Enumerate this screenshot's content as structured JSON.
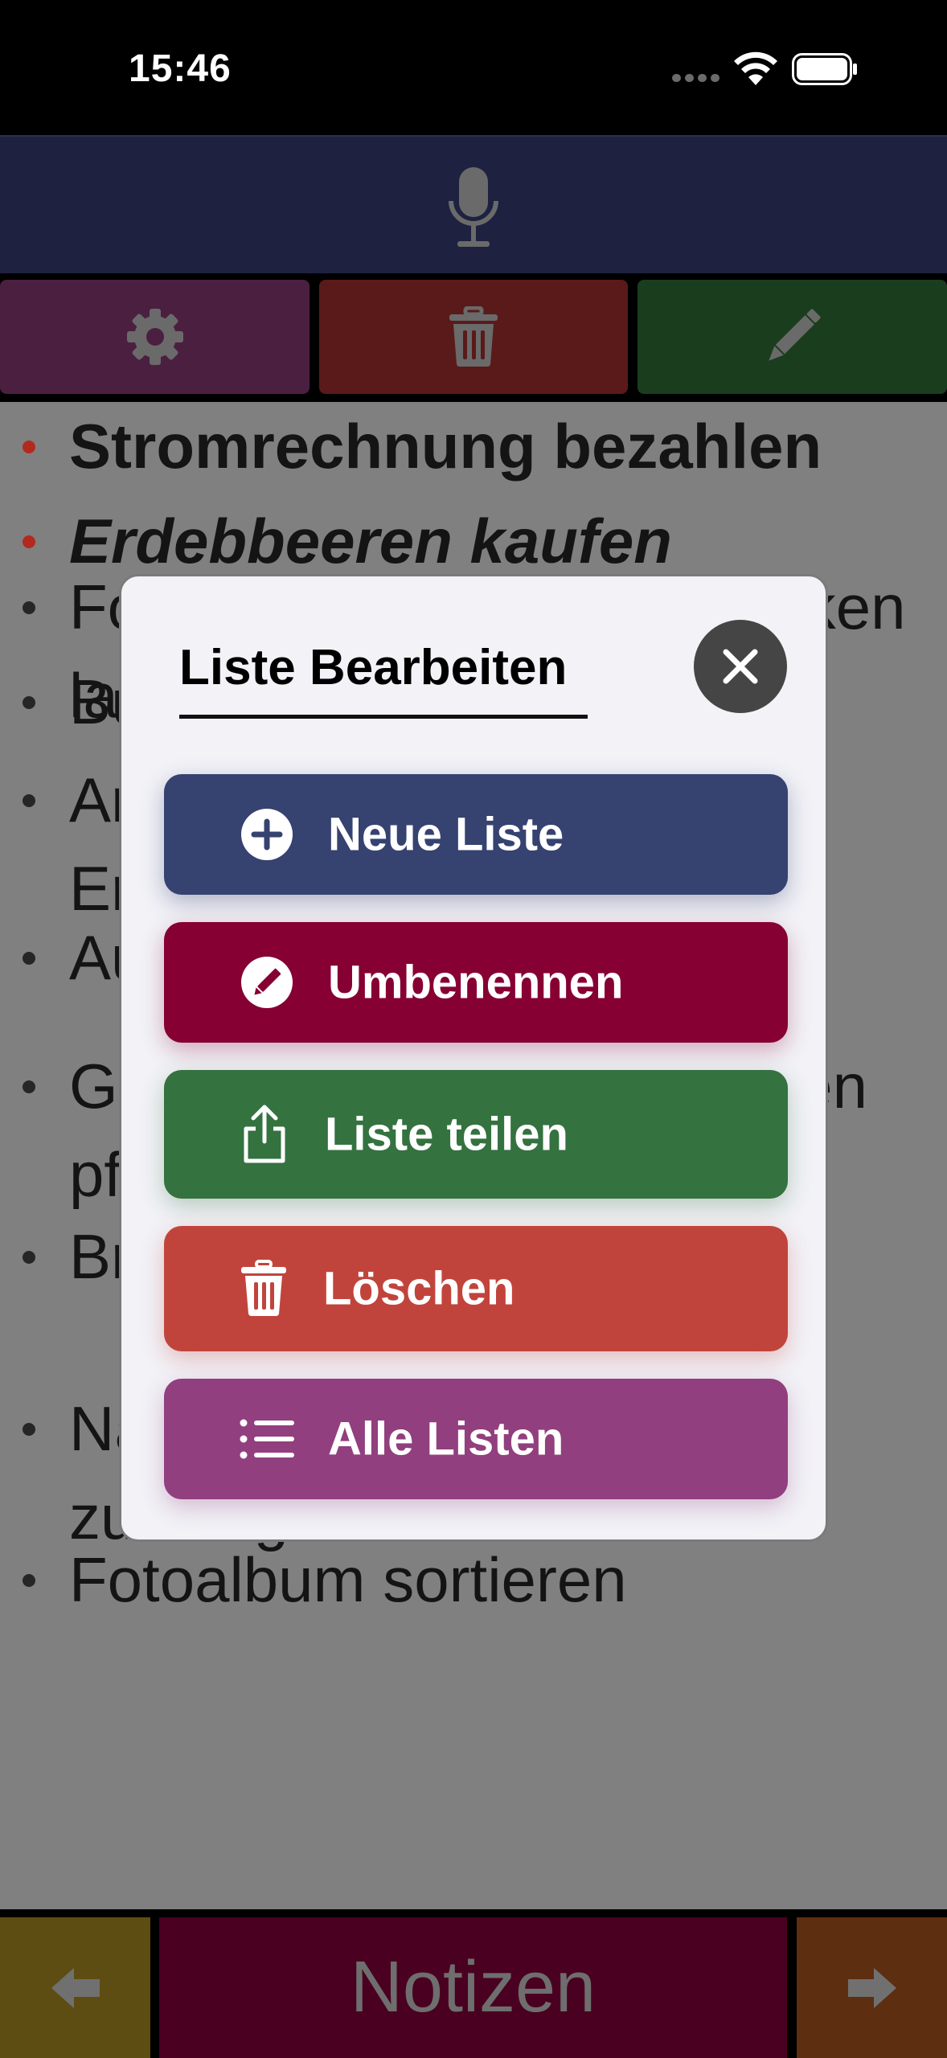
{
  "status_bar": {
    "time": "15:46"
  },
  "toolbar": {
    "mic_icon": "microphone-icon",
    "settings_icon": "gear-icon",
    "delete_icon": "trash-icon",
    "edit_icon": "pencil-icon"
  },
  "notes": [
    {
      "text": "Stromrechnung bezahlen",
      "style": "bold",
      "bullet_color": "#b22a1e"
    },
    {
      "text": "Erdebbeeren kaufen",
      "style": "bolditalic",
      "bullet_color": "#b22a1e"
    },
    {
      "text": "Fotos vom Urlaub ausdrucken lassen",
      "style": "normal",
      "bullet_color": "#262626"
    },
    {
      "text": "Bücher zurückbringen",
      "style": "normal",
      "bullet_color": "#262626"
    },
    {
      "text": "An Geburtstag von Tante Erika erinnern",
      "style": "normal",
      "bullet_color": "#262626"
    },
    {
      "text": "Auto waschen",
      "style": "normal",
      "bullet_color": "#262626"
    },
    {
      "text": "Garten gießen und Geranien pflanzen",
      "style": "normal",
      "bullet_color": "#262626"
    },
    {
      "text": "Brief zur Post bringen",
      "style": "normal",
      "bullet_color": "#262626"
    },
    {
      "text": "Nachbarn Schlüssel zurückgeben",
      "style": "normal",
      "bullet_color": "#262626"
    },
    {
      "text": "Fotoalbum sortieren",
      "style": "normal",
      "bullet_color": "#262626"
    }
  ],
  "bottom_bar": {
    "title": "Notizen",
    "prev_icon": "arrow-left-icon",
    "next_icon": "arrow-right-icon"
  },
  "modal": {
    "title": "Liste Bearbeiten",
    "close_icon": "close-icon",
    "actions": [
      {
        "label": "Neue Liste",
        "icon": "plus-circle-icon",
        "color": "#364270"
      },
      {
        "label": "Umbenennen",
        "icon": "pencil-circle-icon",
        "color": "#860033"
      },
      {
        "label": "Liste teilen",
        "icon": "share-icon",
        "color": "#347240"
      },
      {
        "label": "Löschen",
        "icon": "trash-icon",
        "color": "#c1443c"
      },
      {
        "label": "Alle Listen",
        "icon": "list-icon",
        "color": "#913f7e"
      }
    ]
  }
}
